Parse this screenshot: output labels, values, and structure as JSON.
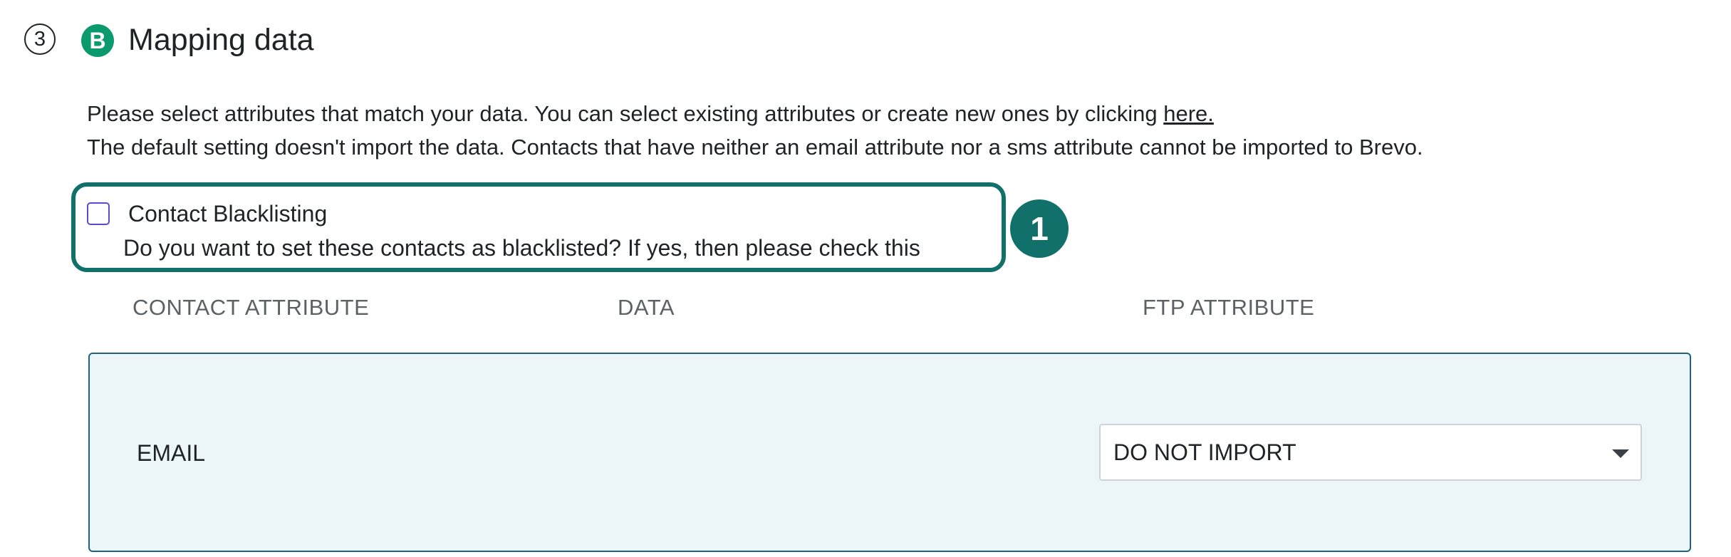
{
  "step": {
    "number": "3",
    "title": "Mapping data",
    "logo_letter": "B",
    "logo_color": "#0b9a6d"
  },
  "description": {
    "line1_text": "Please select attributes that match your data. You can select existing attributes or create new ones by clicking ",
    "line1_link": "here.",
    "line2_text": "The default setting doesn't import the data. Contacts that have neither an email attribute nor a sms attribute cannot be imported to Brevo."
  },
  "blacklist": {
    "label": "Contact Blacklisting",
    "help": "Do you want to set these contacts as blacklisted? If yes, then please check this",
    "checked": false
  },
  "callout": {
    "number": "1",
    "color": "#12706b"
  },
  "table": {
    "headers": {
      "contact_attribute": "CONTACT ATTRIBUTE",
      "data": "DATA",
      "ftp_attribute": "FTP ATTRIBUTE"
    },
    "rows": [
      {
        "attribute": "EMAIL",
        "data": "",
        "ftp_value": "DO NOT IMPORT"
      }
    ]
  },
  "colors": {
    "row_background": "#ecf6f8",
    "row_border": "#1f6180",
    "checkbox_border": "#5b4bd0"
  }
}
